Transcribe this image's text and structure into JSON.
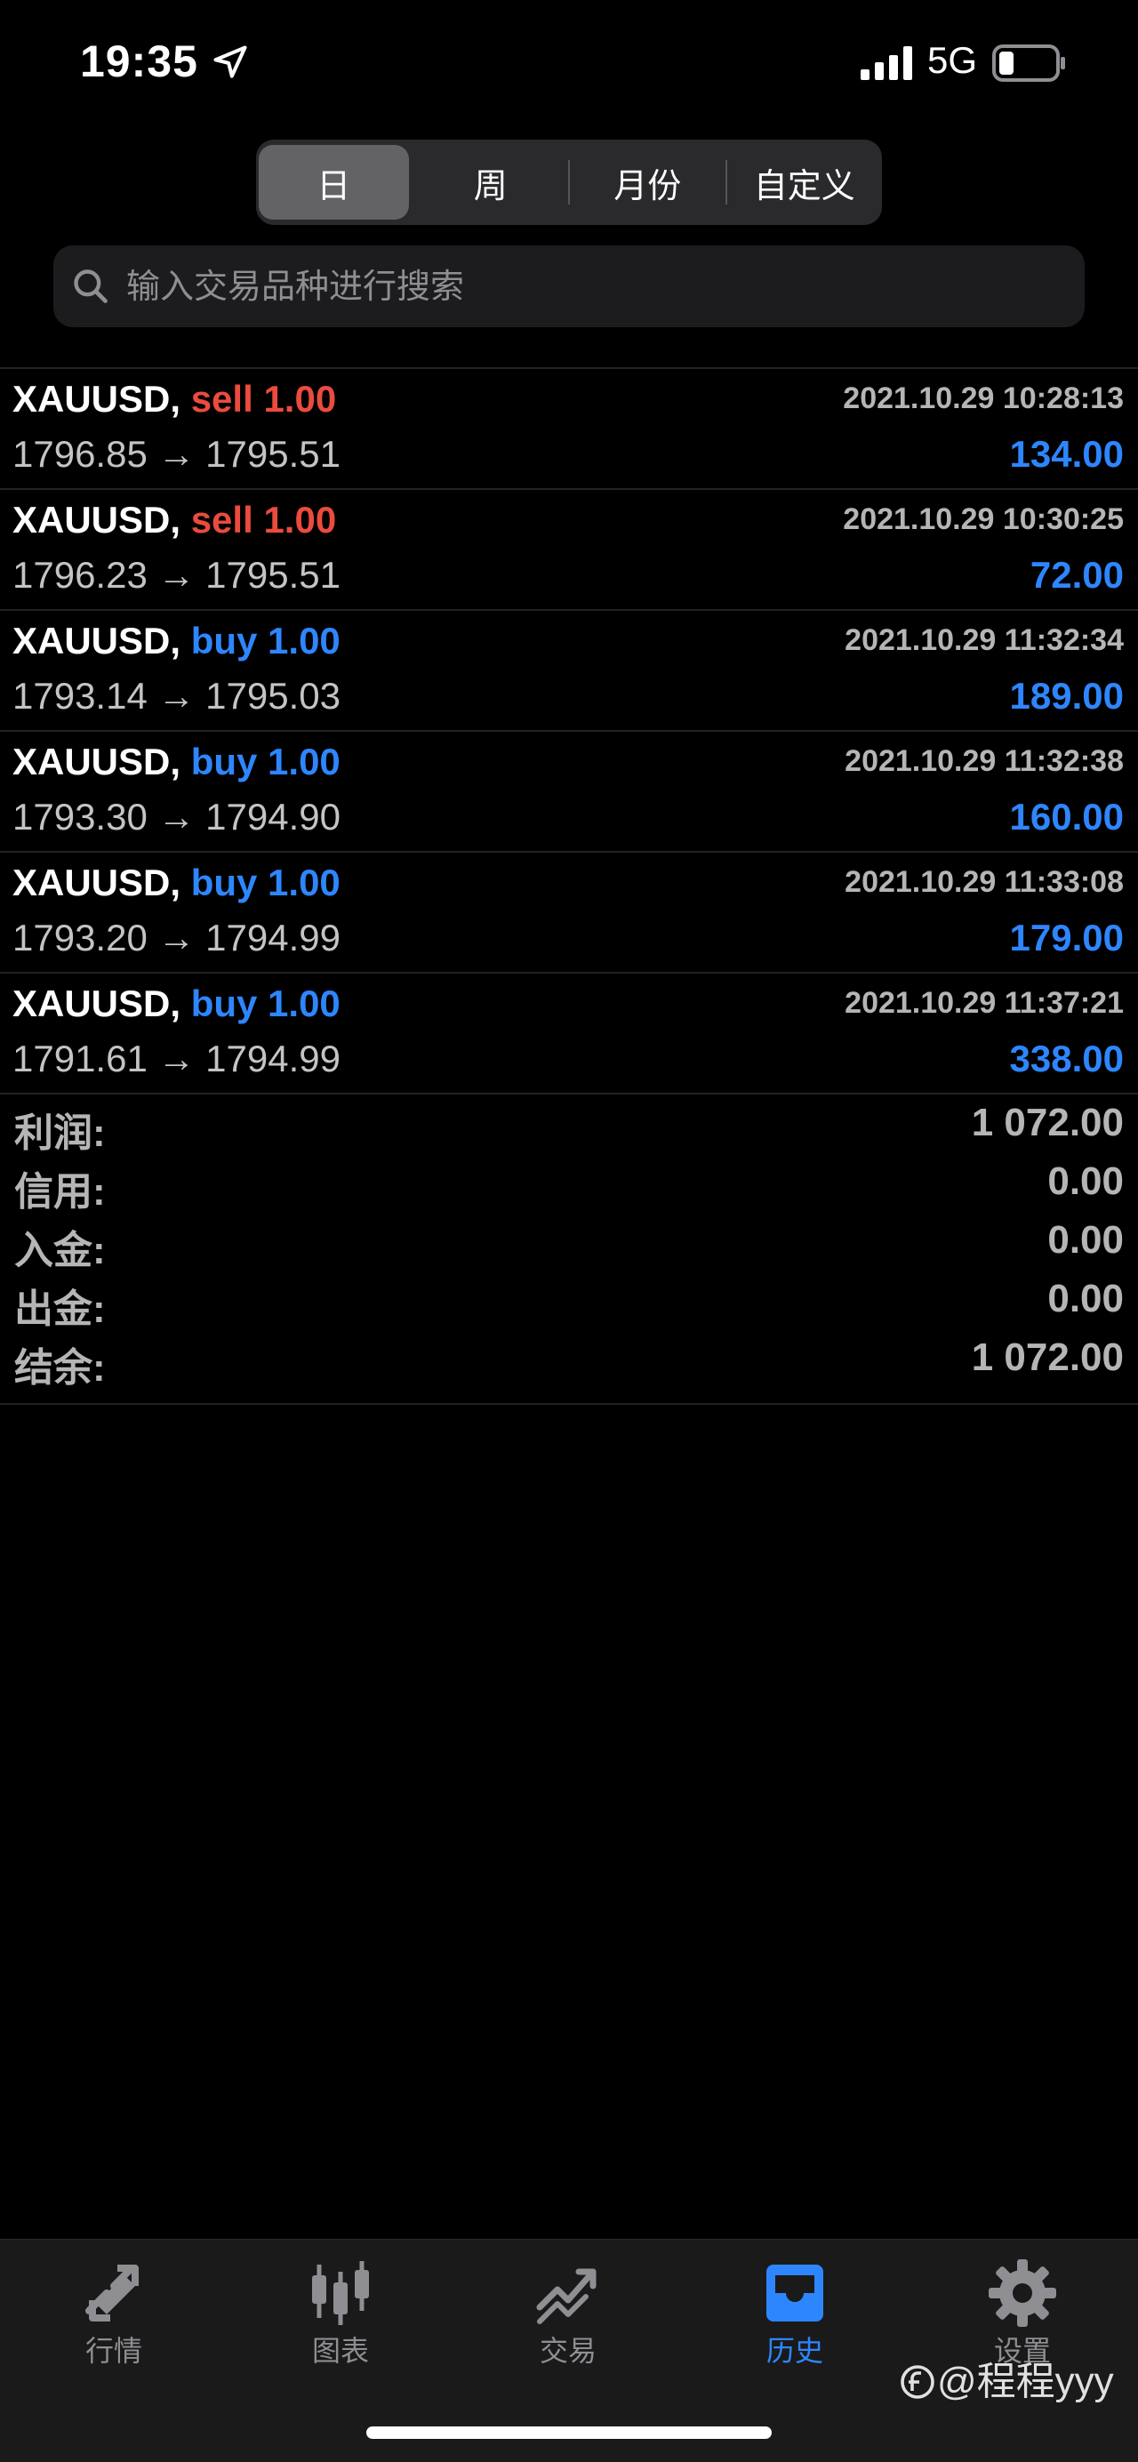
{
  "status": {
    "time": "19:35",
    "network": "5G"
  },
  "period_tabs": [
    {
      "label": "日",
      "active": true
    },
    {
      "label": "周",
      "active": false
    },
    {
      "label": "月份",
      "active": false
    },
    {
      "label": "自定义",
      "active": false
    }
  ],
  "search": {
    "placeholder": "输入交易品种进行搜索",
    "value": ""
  },
  "trades": [
    {
      "symbol": "XAUUSD,",
      "side": "sell",
      "volume": "1.00",
      "datetime": "2021.10.29 10:28:13",
      "prices": "1796.85 → 1795.51",
      "profit": "134.00"
    },
    {
      "symbol": "XAUUSD,",
      "side": "sell",
      "volume": "1.00",
      "datetime": "2021.10.29 10:30:25",
      "prices": "1796.23 → 1795.51",
      "profit": "72.00"
    },
    {
      "symbol": "XAUUSD,",
      "side": "buy",
      "volume": "1.00",
      "datetime": "2021.10.29 11:32:34",
      "prices": "1793.14 → 1795.03",
      "profit": "189.00"
    },
    {
      "symbol": "XAUUSD,",
      "side": "buy",
      "volume": "1.00",
      "datetime": "2021.10.29 11:32:38",
      "prices": "1793.30 → 1794.90",
      "profit": "160.00"
    },
    {
      "symbol": "XAUUSD,",
      "side": "buy",
      "volume": "1.00",
      "datetime": "2021.10.29 11:33:08",
      "prices": "1793.20 → 1794.99",
      "profit": "179.00"
    },
    {
      "symbol": "XAUUSD,",
      "side": "buy",
      "volume": "1.00",
      "datetime": "2021.10.29 11:37:21",
      "prices": "1791.61 → 1794.99",
      "profit": "338.00"
    }
  ],
  "summary": [
    {
      "label": "利润:",
      "value": "1 072.00"
    },
    {
      "label": "信用:",
      "value": "0.00"
    },
    {
      "label": "入金:",
      "value": "0.00"
    },
    {
      "label": "出金:",
      "value": "0.00"
    },
    {
      "label": "结余:",
      "value": "1 072.00"
    }
  ],
  "tabbar": [
    {
      "label": "行情",
      "icon": "quotes-icon",
      "active": false
    },
    {
      "label": "图表",
      "icon": "chart-icon",
      "active": false
    },
    {
      "label": "交易",
      "icon": "trade-icon",
      "active": false
    },
    {
      "label": "历史",
      "icon": "history-icon",
      "active": true
    },
    {
      "label": "设置",
      "icon": "settings-icon",
      "active": false
    }
  ],
  "watermark": "@程程yyy",
  "colors": {
    "sell": "#eb4b3e",
    "buy": "#2e86ff",
    "active_tab": "#2e86ff",
    "inactive_tab": "#8e8e93"
  }
}
